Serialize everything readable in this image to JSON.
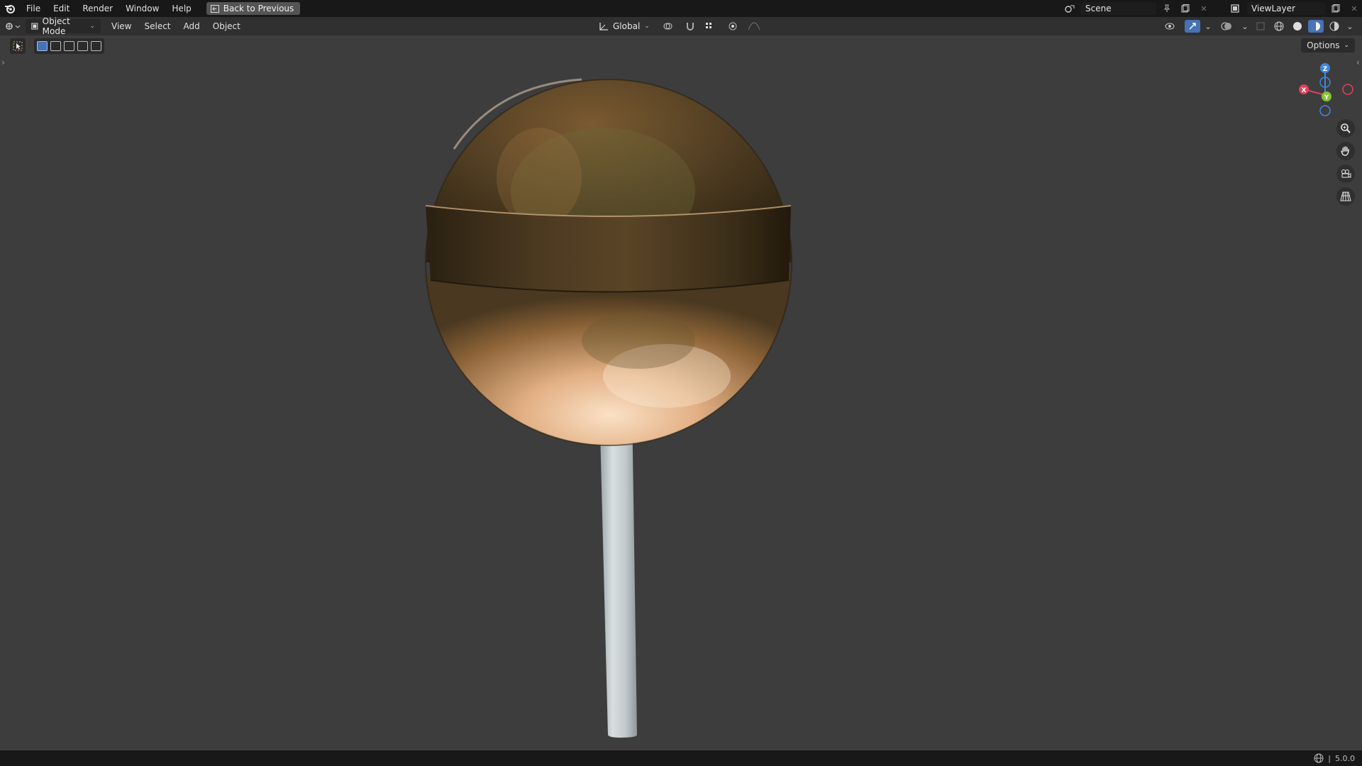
{
  "menus": [
    "File",
    "Edit",
    "Render",
    "Window",
    "Help"
  ],
  "back_button": "Back to Previous",
  "scene": "Scene",
  "view_layer": "ViewLayer",
  "mode": "Object Mode",
  "header_menus": [
    "View",
    "Select",
    "Add",
    "Object"
  ],
  "transform_orientation": "Global",
  "options_label": "Options",
  "gizmo": {
    "x": "X",
    "y": "Y",
    "z": "Z"
  },
  "version": "5.0.0",
  "colors": {
    "x_axis": "#e0415b",
    "y_axis": "#84c334",
    "z_axis": "#3f86e0",
    "active": "#4772b3"
  },
  "icons": [
    "blender-logo-icon",
    "back-icon",
    "scene-icon",
    "pin-icon",
    "new-scene-icon",
    "close-icon",
    "view-layer-icon",
    "editor-type-icon",
    "object-mode-icon",
    "orientation-icon",
    "pivot-icon",
    "snap-icon",
    "proportional-icon",
    "visibility-icon",
    "gizmo-icon",
    "overlay-icon",
    "xray-icon",
    "wireframe-icon",
    "solid-icon",
    "material-icon",
    "rendered-icon",
    "zoom-icon",
    "pan-icon",
    "camera-icon",
    "perspective-icon",
    "network-icon"
  ]
}
